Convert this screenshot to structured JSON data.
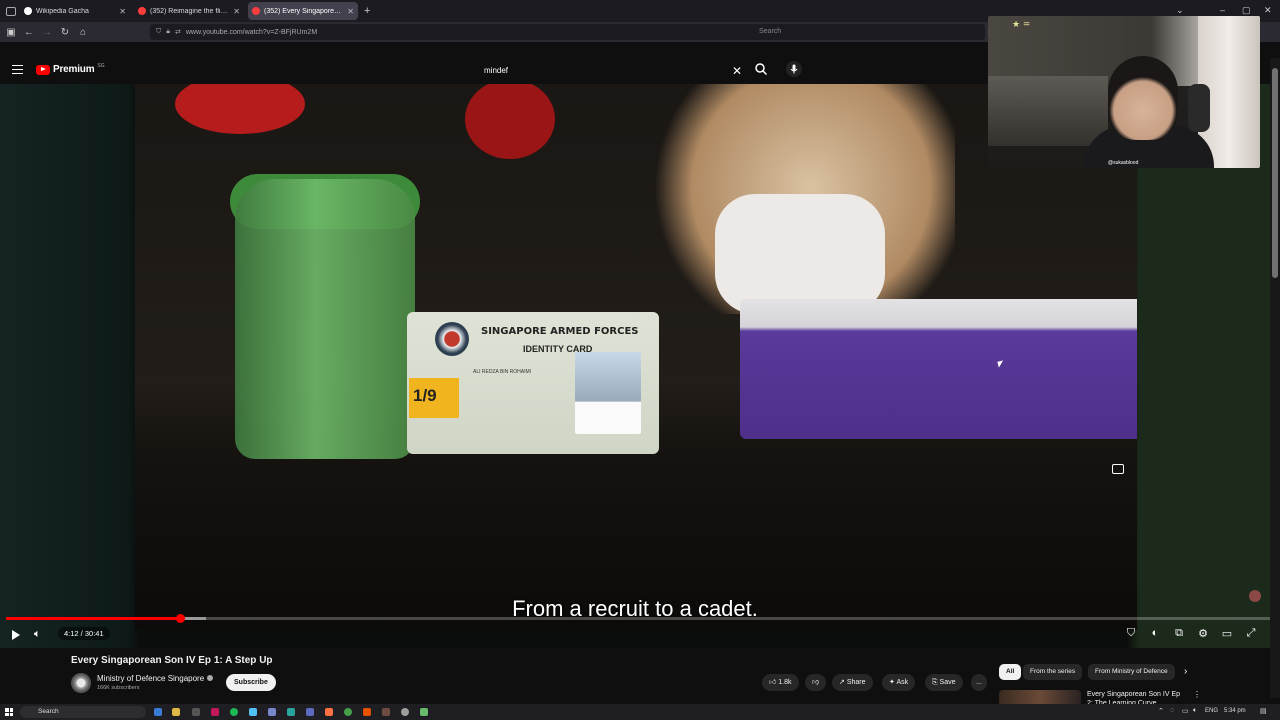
{
  "browser": {
    "tabs": [
      {
        "title": "Wikipedia Gacha",
        "icon": "globe-icon",
        "active": false,
        "color": "#ffffff"
      },
      {
        "title": "(352) Reimagine the flight",
        "icon": "youtube-icon",
        "active": false,
        "color": "#ff3d3d"
      },
      {
        "title": "(352) Every Singaporean Son IV",
        "icon": "youtube-icon",
        "active": true,
        "color": "#ff3d3d"
      }
    ],
    "new_tab": "+",
    "url": "www.youtube.com/watch?v=Z-BFjRUm2M",
    "search_placeholder": "Search"
  },
  "youtube": {
    "logo_text": "Premium",
    "logo_badge": "SG",
    "search_value": "mindef",
    "video": {
      "subtitle": "From a recruit to a cadet.",
      "time": "4:12 / 30:41",
      "progress_fraction": 0.137,
      "buffered_fraction": 0.158,
      "card_org": "SINGAPORE ARMED FORCES",
      "card_type": "IDENTITY CARD",
      "card_name": "ALI REDZA BIN ROHAIMI",
      "card_rank": "1/9"
    },
    "title": "Every Singaporean Son IV Ep 1: A Step Up",
    "channel": {
      "name": "Ministry of Defence Singapore",
      "subscribers": "166K subscribers",
      "subscribe_label": "Subscribe"
    },
    "actions": {
      "likes": "1.8k",
      "share": "Share",
      "ask": "Ask",
      "save": "Save",
      "more": "..."
    },
    "chips": [
      "All",
      "From the series",
      "From Ministry of Defence"
    ],
    "recommendation": {
      "title": "Every Singaporean Son IV Ep 2: The Learning Curve"
    }
  },
  "webcam": {
    "handle": "@sukasblood",
    "logo": "★ ="
  },
  "taskbar": {
    "search_label": "Search",
    "lang": "ENG",
    "clock": "5:34 pm"
  },
  "colors": {
    "accent": "#ff0000",
    "page_bg": "#0f0f0f",
    "chrome_bg": "#2b2a33"
  }
}
